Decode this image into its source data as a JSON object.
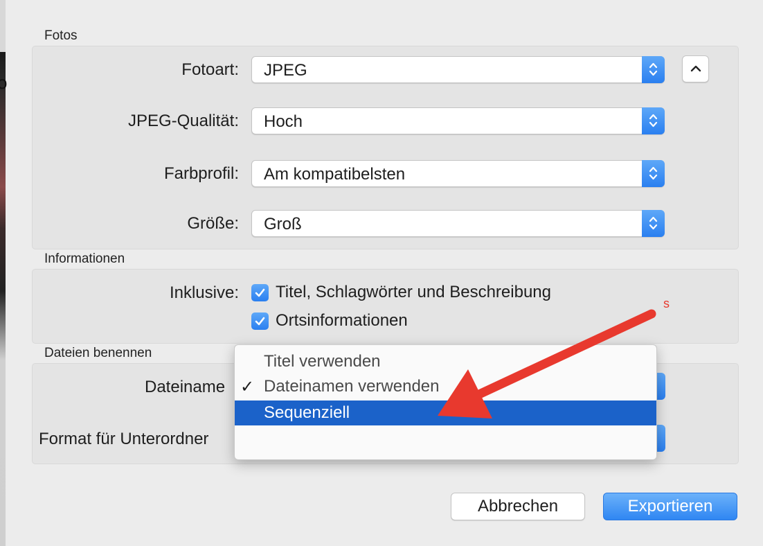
{
  "sections": {
    "fotos": "Fotos",
    "informationen": "Informationen",
    "dateien_benennen": "Dateien benennen"
  },
  "fotos": {
    "fotoart_label": "Fotoart:",
    "fotoart_value": "JPEG",
    "qualitaet_label": "JPEG-Qualität:",
    "qualitaet_value": "Hoch",
    "farbprofil_label": "Farbprofil:",
    "farbprofil_value": "Am kompatibelsten",
    "groesse_label": "Größe:",
    "groesse_value": "Groß"
  },
  "informationen": {
    "inklusive_label": "Inklusive:",
    "option_titel": "Titel, Schlagwörter und Beschreibung",
    "option_titel_checked": true,
    "option_orts": "Ortsinformationen",
    "option_orts_checked": true
  },
  "dateien": {
    "dateiname_label": "Dateiname",
    "unterordner_label": "Format für Unterordner"
  },
  "dropdown": {
    "items": [
      {
        "label": "Titel verwenden",
        "checked": false,
        "selected": false
      },
      {
        "label": "Dateinamen verwenden",
        "checked": true,
        "selected": false
      },
      {
        "label": "Sequenziell",
        "checked": false,
        "selected": true
      },
      {
        "label": "",
        "checked": false,
        "selected": false
      }
    ],
    "check_glyph": "✓"
  },
  "buttons": {
    "cancel": "Abbrechen",
    "export": "Exportieren"
  },
  "annotation": {
    "letter": "s",
    "color": "#e8392e"
  },
  "colors": {
    "accent": "#2a7ff0",
    "selection": "#1b62c9"
  }
}
